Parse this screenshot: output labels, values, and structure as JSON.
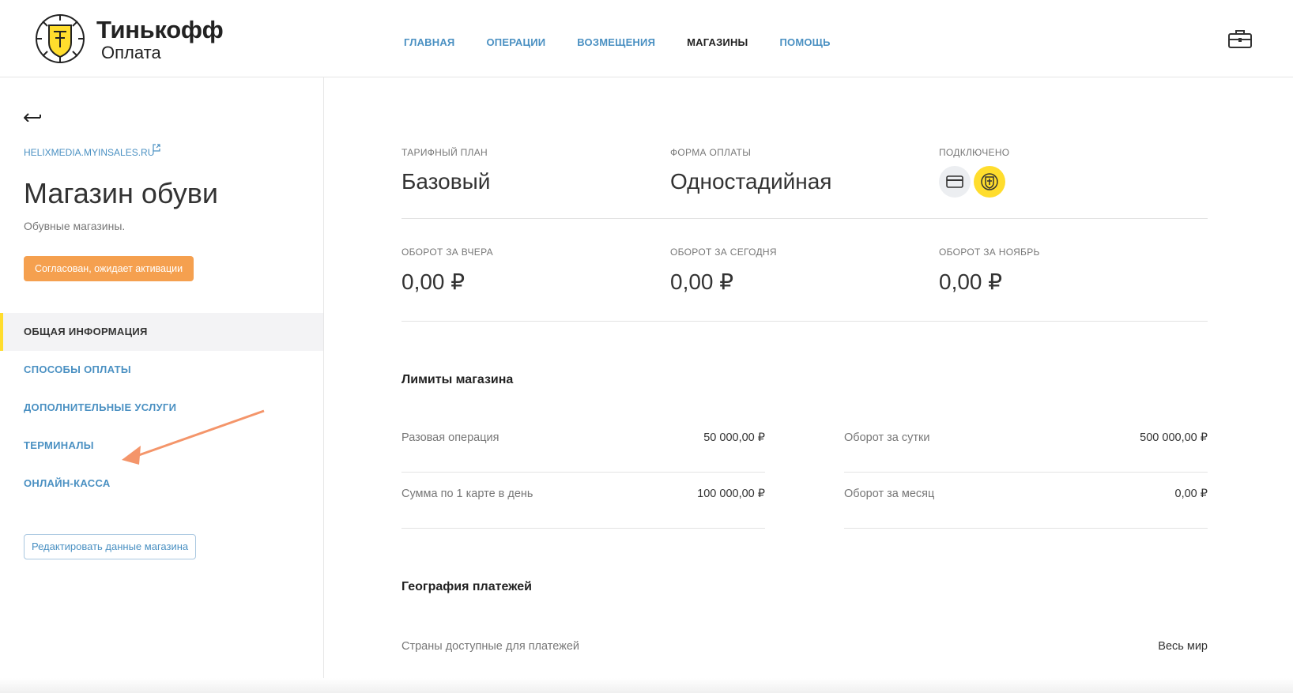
{
  "brand": {
    "title": "Тинькофф",
    "subtitle": "Оплата",
    "accent": "#ffdd2d",
    "link_color": "#4a90c2",
    "badge_color": "#f5a04f"
  },
  "nav": {
    "items": [
      {
        "label": "ГЛАВНАЯ",
        "active": false
      },
      {
        "label": "ОПЕРАЦИИ",
        "active": false
      },
      {
        "label": "ВОЗМЕЩЕНИЯ",
        "active": false
      },
      {
        "label": "МАГАЗИНЫ",
        "active": true
      },
      {
        "label": "ПОМОЩЬ",
        "active": false
      }
    ],
    "icon": "briefcase-icon"
  },
  "sidebar": {
    "store_link": "HELIXMEDIA.MYINSALES.RU",
    "store_name": "Магазин обуви",
    "store_description": "Обувные магазины.",
    "status": "Согласован, ожидает активации",
    "menu": [
      {
        "label": "ОБЩАЯ ИНФОРМАЦИЯ",
        "active": true
      },
      {
        "label": "СПОСОБЫ ОПЛАТЫ",
        "active": false
      },
      {
        "label": "ДОПОЛНИТЕЛЬНЫЕ УСЛУГИ",
        "active": false
      },
      {
        "label": "ТЕРМИНАЛЫ",
        "active": false
      },
      {
        "label": "ОНЛАЙН-КАССА",
        "active": false
      }
    ],
    "edit_button": "Редактировать данные магазина"
  },
  "main": {
    "info": {
      "tariff_label": "ТАРИФНЫЙ ПЛАН",
      "tariff_value": "Базовый",
      "payment_form_label": "ФОРМА ОПЛАТЫ",
      "payment_form_value": "Одностадийная",
      "connected_label": "ПОДКЛЮЧЕНО",
      "connected_icons": [
        "card-icon",
        "tinkoff-emblem-icon"
      ]
    },
    "turnover": {
      "yesterday_label": "ОБОРОТ ЗА ВЧЕРА",
      "yesterday_value": "0,00 ₽",
      "today_label": "ОБОРОТ ЗА СЕГОДНЯ",
      "today_value": "0,00 ₽",
      "month_label": "ОБОРОТ ЗА НОЯБРЬ",
      "month_value": "0,00 ₽"
    },
    "limits": {
      "title": "Лимиты магазина",
      "rows": [
        {
          "label": "Разовая операция",
          "value": "50 000,00 ₽"
        },
        {
          "label": "Оборот за сутки",
          "value": "500 000,00 ₽"
        },
        {
          "label": "Сумма по 1 карте в день",
          "value": "100 000,00 ₽"
        },
        {
          "label": "Оборот за месяц",
          "value": "0,00 ₽"
        }
      ]
    },
    "geography": {
      "title": "География платежей",
      "countries_label": "Страны доступные для платежей",
      "countries_value": "Весь мир"
    }
  }
}
